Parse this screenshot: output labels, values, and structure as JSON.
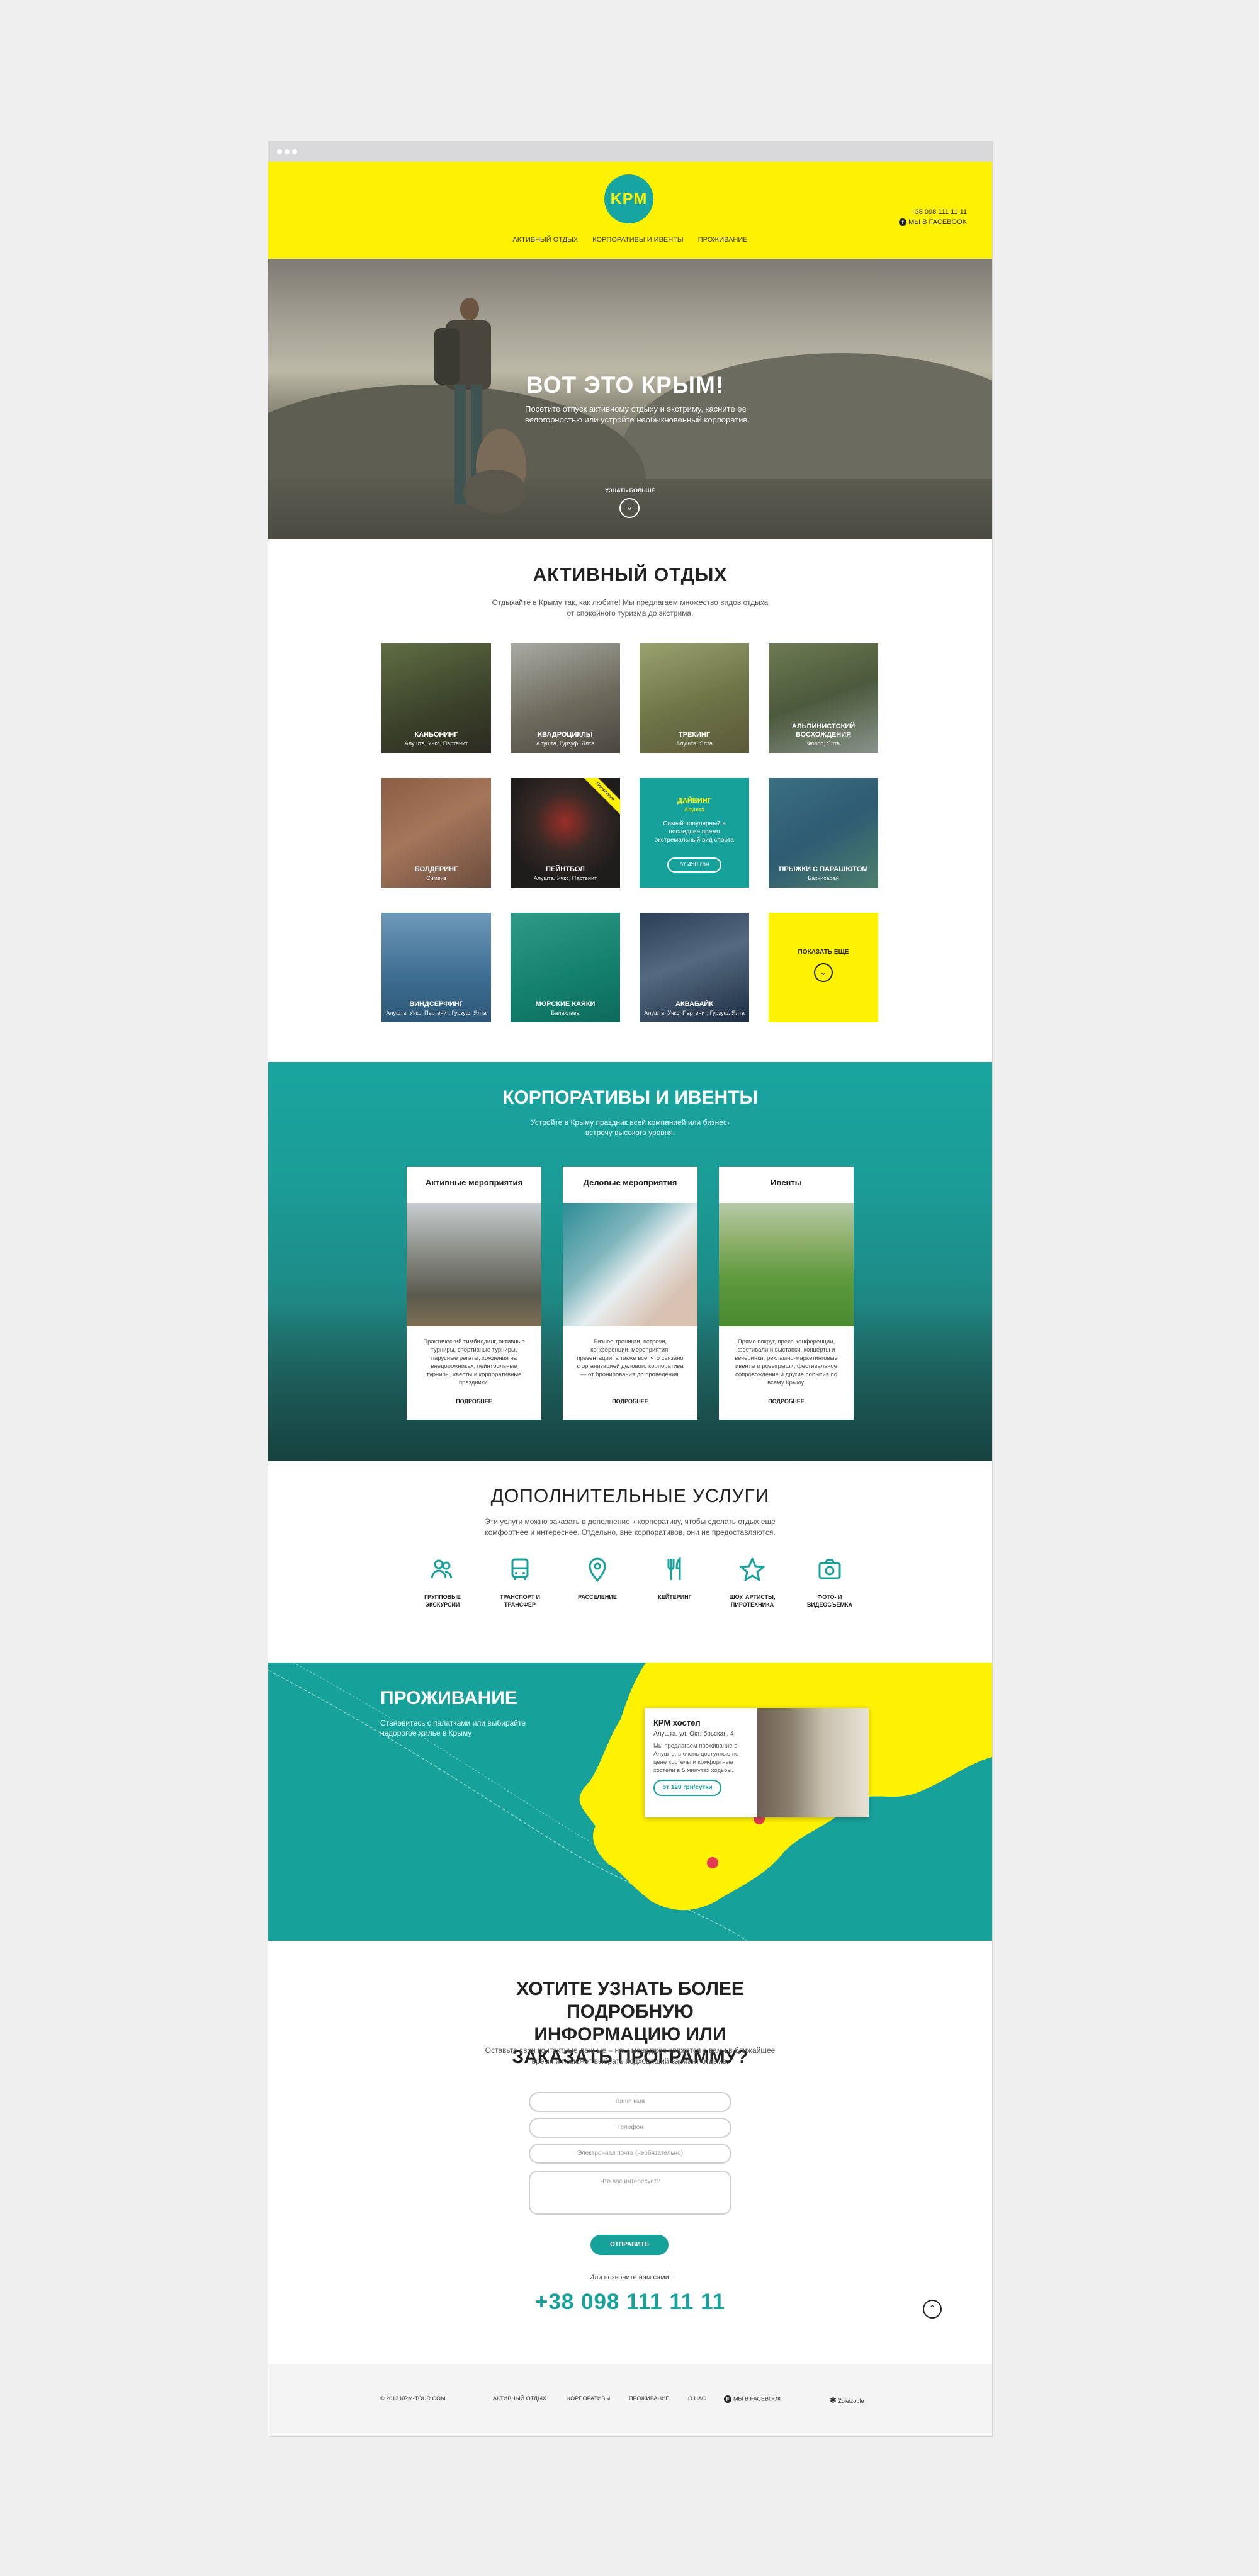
{
  "header": {
    "logo": "KPM",
    "nav": [
      "Активный отдых",
      "Корпоративы и ивенты",
      "Проживание"
    ],
    "phone": "+38 098 111 11 11",
    "facebook": "Мы в Facebook"
  },
  "hero": {
    "title": "Вот это Крым!",
    "text": "Посетите отпуск активному отдыху и экстриму, касните ее велогорностью или устройте необыкновенный корпоратив.",
    "more": "Узнать больше"
  },
  "active": {
    "title": "Активный отдых",
    "subtitle": "Отдыхайте в Крыму так, как любите! Мы предлагаем множество видов отдыха от спокойного туризма до экстрима.",
    "tiles": [
      {
        "label": "Каньонинг",
        "location": "Алушта, Учкс, Партенит"
      },
      {
        "label": "Квадроциклы",
        "location": "Алушта, Гурзуф, Ялта"
      },
      {
        "label": "Трекинг",
        "location": "Алушта, Ялта"
      },
      {
        "label": "Альпинистский восхождения",
        "location": "Форос, Ялта"
      },
      {
        "label": "Болдеринг",
        "location": "Симеиз"
      },
      {
        "label": "Пейнтбол",
        "location": "Алушта, Учкс, Партенит",
        "badge": "Популярно"
      },
      {
        "label": "Дайвинг",
        "location": "Алушта",
        "desc": "Самый популярный в последнее время экстремальный вид спорта",
        "price": "от 450 грн"
      },
      {
        "label": "Прыжки с парашютом",
        "location": "Бахчисарай"
      },
      {
        "label": "Виндсерфинг",
        "location": "Алушта, Учкс, Партенит, Гурзуф, Ялта"
      },
      {
        "label": "Морские каяки",
        "location": "Балаклава"
      },
      {
        "label": "Аквабайк",
        "location": "Алушта, Учкс, Партенит, Гурзуф, Ялта"
      }
    ],
    "more": "Показать еще"
  },
  "corporate": {
    "title": "Корпоративы и ивенты",
    "subtitle": "Устройте в Крыму праздник всей компанией или бизнес-встречу высокого уровня.",
    "cards": [
      {
        "title": "Активные мероприятия",
        "desc": "Практический тимбилдинг, активные турниры, спортивные турниры, парусные регаты, хождения на внедорожниках, пейнтбольные турниры, квесты и корпоративные праздники.",
        "more": "Подробнее"
      },
      {
        "title": "Деловые мероприятия",
        "desc": "Бизнес-тренинги, встречи, конференции, мероприятия, презентации, а также все, что связано с организацией делового корпоратива — от бронирования до проведения.",
        "more": "Подробнее"
      },
      {
        "title": "Ивенты",
        "desc": "Прямо вокруг, пресс-конференции, фестивали и выставки, концерты и вечеринки, рекламно-маркетинговые ивенты и розыгрыши, фестивальное сопровождение и другие события по всему Крыму.",
        "more": "Подробнее"
      }
    ]
  },
  "services": {
    "title": "Дополнительные услуги",
    "subtitle": "Эти услуги можно заказать в дополнение к корпоративу, чтобы сделать отдых еще комфортнее и интереснее. Отдельно, вне корпоративов, они не предоставляются.",
    "items": [
      {
        "icon": "people-icon",
        "label": "Групповые экскурсии"
      },
      {
        "icon": "bus-icon",
        "label": "Транспорт и трансфер"
      },
      {
        "icon": "location-pin-icon",
        "label": "Расселение"
      },
      {
        "icon": "cutlery-icon",
        "label": "Кейтеринг"
      },
      {
        "icon": "star-icon",
        "label": "Шоу, артисты, пиротехника"
      },
      {
        "icon": "camera-icon",
        "label": "Фото- и видеосъемка"
      }
    ]
  },
  "housing": {
    "title": "Проживание",
    "subtitle": "Становитесь с палатками или выбирайте недорогое жилье в Крыму",
    "hostel": {
      "name": "КРМ хостел",
      "address": "Алушта, ул. Октябрьская, 4",
      "desc": "Мы предлагаем проживание в Алуште, в очень доступные по цене хостелы и комфортные хостели в 5 минутах ходьбы.",
      "price": "от 120 грн/сутки"
    }
  },
  "contact": {
    "title": "Хотите узнать более подробную информацию или заказать программу?",
    "subtitle": "Оставьте свои контактные данные – наш менеджер свяжется с вами в ближайшее время и поможет выбрать подходящий вариант отдыха.",
    "name_placeholder": "Ваше имя",
    "phone_placeholder": "Телефон",
    "email_placeholder": "Электронная почта (необязательно)",
    "interest_placeholder": "Что вас интересует?",
    "send": "Отправить",
    "call": "Или позвоните нам сами:",
    "phone": "+38 098 111 11 11"
  },
  "footer": {
    "copyright": "© 2013 KRM-TOUR.COM",
    "links": [
      "Активный отдых",
      "Корпоративы",
      "Проживание",
      "О нас"
    ],
    "facebook": "Мы в Facebook",
    "credit": "Zoleizoble"
  },
  "colors": {
    "yellow": "#fff200",
    "teal": "#17a19b"
  }
}
